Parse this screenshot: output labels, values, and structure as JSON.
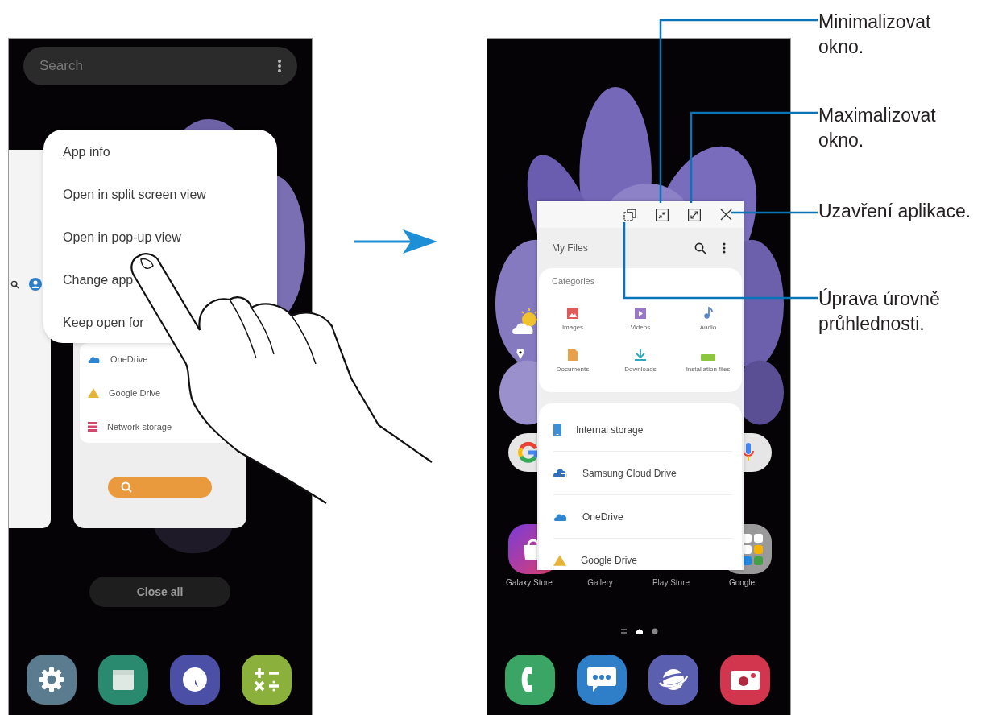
{
  "left_screen": {
    "search": {
      "placeholder": "Search"
    },
    "context_menu": [
      {
        "label": "App info"
      },
      {
        "label": "Open in split screen view"
      },
      {
        "label": "Open in pop-up view"
      },
      {
        "label": "Change app"
      },
      {
        "label": "Keep open for"
      }
    ],
    "app_card": {
      "storage": [
        {
          "label": "OneDrive",
          "kind": "onedrive"
        },
        {
          "label": "Google Drive",
          "kind": "gdrive"
        },
        {
          "label": "Network storage",
          "kind": "network"
        }
      ]
    },
    "close_all": "Close all",
    "dock": [
      {
        "kind": "settings"
      },
      {
        "kind": "calendar"
      },
      {
        "kind": "clock"
      },
      {
        "kind": "calculator"
      }
    ]
  },
  "right_screen": {
    "popup": {
      "title": "My Files",
      "categories_title": "Categories",
      "categories": [
        {
          "label": "Images",
          "kind": "images"
        },
        {
          "label": "Videos",
          "kind": "videos"
        },
        {
          "label": "Audio",
          "kind": "audio"
        },
        {
          "label": "Documents",
          "kind": "documents"
        },
        {
          "label": "Downloads",
          "kind": "downloads"
        },
        {
          "label": "Installation files",
          "kind": "apk"
        }
      ],
      "storage": [
        {
          "label": "Internal storage",
          "kind": "phone"
        },
        {
          "label": "Samsung Cloud Drive",
          "kind": "cloud"
        },
        {
          "label": "OneDrive",
          "kind": "onedrive"
        },
        {
          "label": "Google Drive",
          "kind": "gdrive"
        }
      ]
    },
    "home_apps": [
      {
        "label": "Galaxy Store",
        "kind": "store"
      },
      {
        "label": "Gallery",
        "kind": "hidden"
      },
      {
        "label": "Play Store",
        "kind": "hidden"
      },
      {
        "label": "Google",
        "kind": "folder"
      }
    ],
    "dock": [
      {
        "kind": "phone"
      },
      {
        "kind": "messages"
      },
      {
        "kind": "internet"
      },
      {
        "kind": "camera"
      }
    ]
  },
  "callouts": [
    {
      "text": "Minimalizovat\nokno."
    },
    {
      "text": "Maximalizovat\nokno."
    },
    {
      "text": "Uzavření aplikace."
    },
    {
      "text": "Úprava úrovně\nprůhlednosti."
    }
  ]
}
